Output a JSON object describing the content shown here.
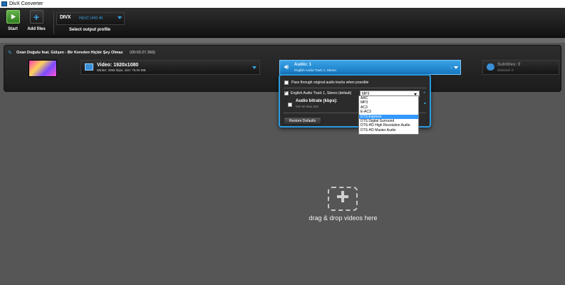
{
  "window": {
    "title": "DivX Converter"
  },
  "toolbar": {
    "start_label": "Start",
    "add_files_label": "Add files",
    "profile_logo": "DIVX",
    "profile_value": "HEVC UHD 4K",
    "profile_label": "Select output profile"
  },
  "file": {
    "title": "Ozan Doğulu feat. Gülşen - Bir Kereden Hiçbir Şey Olmaz",
    "duration": "(00:03:27.360)",
    "video": {
      "title": "Video: 1920x1080",
      "details": "Bitrate: 3056 kbps, size: 76.00 MB"
    },
    "audio": {
      "title": "Audio: 1",
      "details": "English Audio Track 1, Stereo"
    },
    "subtitles": {
      "title": "Subtitles: 0",
      "details": "Selected: 0"
    }
  },
  "audio_popup": {
    "passthrough_label": "Pass through original audio tracks when possible",
    "passthrough_checked": false,
    "track_label": "English Audio Track 1, Stereo  (default)",
    "track_checked": true,
    "codec_value": "MP3",
    "bitrate_title": "Audio bitrate (kbps):",
    "bitrate_range": "Min 80 Max 320",
    "bitrate_checked": false,
    "restore_label": "Restore Defaults",
    "codec_options": [
      "AAC",
      "MP3",
      "AC3",
      "E-AC3",
      "DTS Express",
      "DTS Digital Surround",
      "DTS-HD High Resolution Audio",
      "DTS-HD Master Audio"
    ],
    "codec_selected_index": 4
  },
  "dropzone": {
    "text": "drag & drop videos here"
  },
  "colors": {
    "accent": "#35a6e8",
    "audio_panel": "#1f8bd6",
    "background": "#565656"
  }
}
